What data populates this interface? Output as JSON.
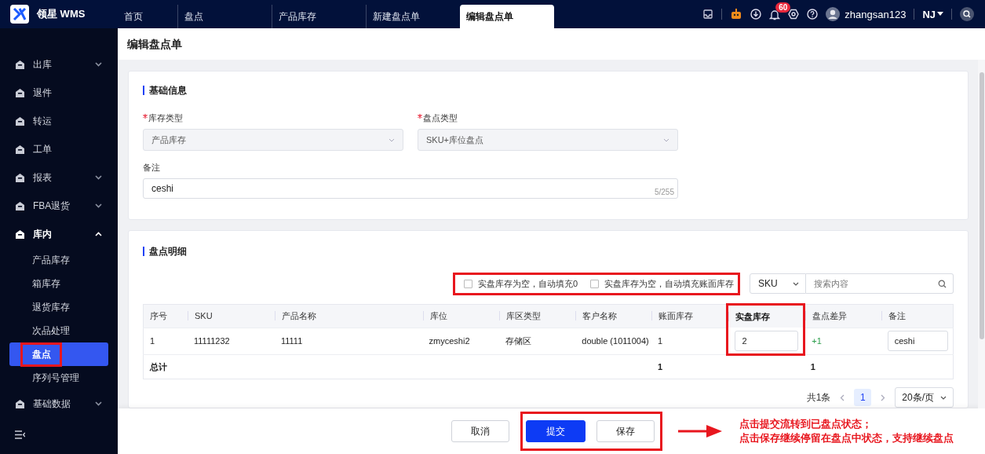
{
  "app": {
    "name": "领星 WMS"
  },
  "tabs": [
    {
      "label": "首页",
      "selected": false
    },
    {
      "label": "盘点",
      "selected": false
    },
    {
      "label": "产品库存",
      "selected": false
    },
    {
      "label": "新建盘点单",
      "selected": false
    },
    {
      "label": "编辑盘点单",
      "selected": true
    }
  ],
  "header": {
    "notification_count": "60",
    "username": "zhangsan123",
    "warehouse": "NJ"
  },
  "sidebar": {
    "items": [
      {
        "label": "出库",
        "has_children": true,
        "expanded": false
      },
      {
        "label": "退件",
        "has_children": false,
        "expanded": false
      },
      {
        "label": "转运",
        "has_children": false,
        "expanded": false
      },
      {
        "label": "工单",
        "has_children": false,
        "expanded": false
      },
      {
        "label": "报表",
        "has_children": true,
        "expanded": false
      },
      {
        "label": "FBA退货",
        "has_children": true,
        "expanded": false
      },
      {
        "label": "库内",
        "has_children": true,
        "expanded": true,
        "children": [
          {
            "label": "产品库存",
            "selected": false,
            "highlighted": false
          },
          {
            "label": "箱库存",
            "selected": false,
            "highlighted": false
          },
          {
            "label": "退货库存",
            "selected": false,
            "highlighted": false
          },
          {
            "label": "次品处理",
            "selected": false,
            "highlighted": false
          },
          {
            "label": "盘点",
            "selected": true,
            "highlighted": true
          },
          {
            "label": "序列号管理",
            "selected": false,
            "highlighted": false
          }
        ]
      },
      {
        "label": "基础数据",
        "has_children": true,
        "expanded": false
      }
    ]
  },
  "page_title": "编辑盘点单",
  "basic_info": {
    "title": "基础信息",
    "fields": [
      {
        "label": "库存类型",
        "required": true,
        "value": "产品库存"
      },
      {
        "label": "盘点类型",
        "required": true,
        "value": "SKU+库位盘点"
      }
    ],
    "remark": {
      "label": "备注",
      "value": "ceshi",
      "counter": "5/255"
    }
  },
  "details": {
    "title": "盘点明细",
    "options": {
      "highlighted": true,
      "items": [
        {
          "label": "实盘库存为空，自动填充0",
          "checked": false
        },
        {
          "label": "实盘库存为空，自动填充账面库存",
          "checked": false
        }
      ]
    },
    "search": {
      "field": "SKU",
      "placeholder": "搜索内容"
    },
    "columns": [
      {
        "label": "序号",
        "highlighted": false
      },
      {
        "label": "SKU",
        "highlighted": false
      },
      {
        "label": "产品名称",
        "highlighted": false
      },
      {
        "label": "库位",
        "highlighted": false
      },
      {
        "label": "库区类型",
        "highlighted": false
      },
      {
        "label": "客户名称",
        "highlighted": false
      },
      {
        "label": "账面库存",
        "highlighted": false
      },
      {
        "label": "实盘库存",
        "highlighted": true
      },
      {
        "label": "盘点差异",
        "highlighted": false
      },
      {
        "label": "备注",
        "highlighted": false
      }
    ],
    "rows": [
      {
        "index": "1",
        "sku": "11111232",
        "product_name": "11111",
        "location": "zmyceshi2",
        "zone_type": "存储区",
        "customer": "double (1011004)",
        "book_qty": "1",
        "actual_qty": "2",
        "difference": "+1",
        "remark": "ceshi"
      }
    ],
    "total": {
      "label": "总计",
      "book_qty": "1",
      "difference": "1"
    },
    "pagination": {
      "total": "共1条",
      "pages": [
        {
          "label": "1",
          "selected": true
        }
      ],
      "page_size": "20条/页"
    }
  },
  "footer": {
    "cancel": "取消",
    "highlighted": true,
    "submit": "提交",
    "save": "保存"
  },
  "annotation": {
    "lines": [
      "点击提交流转到已盘点状态；",
      "点击保存继续停留在盘点中状态，支持继续盘点"
    ]
  }
}
